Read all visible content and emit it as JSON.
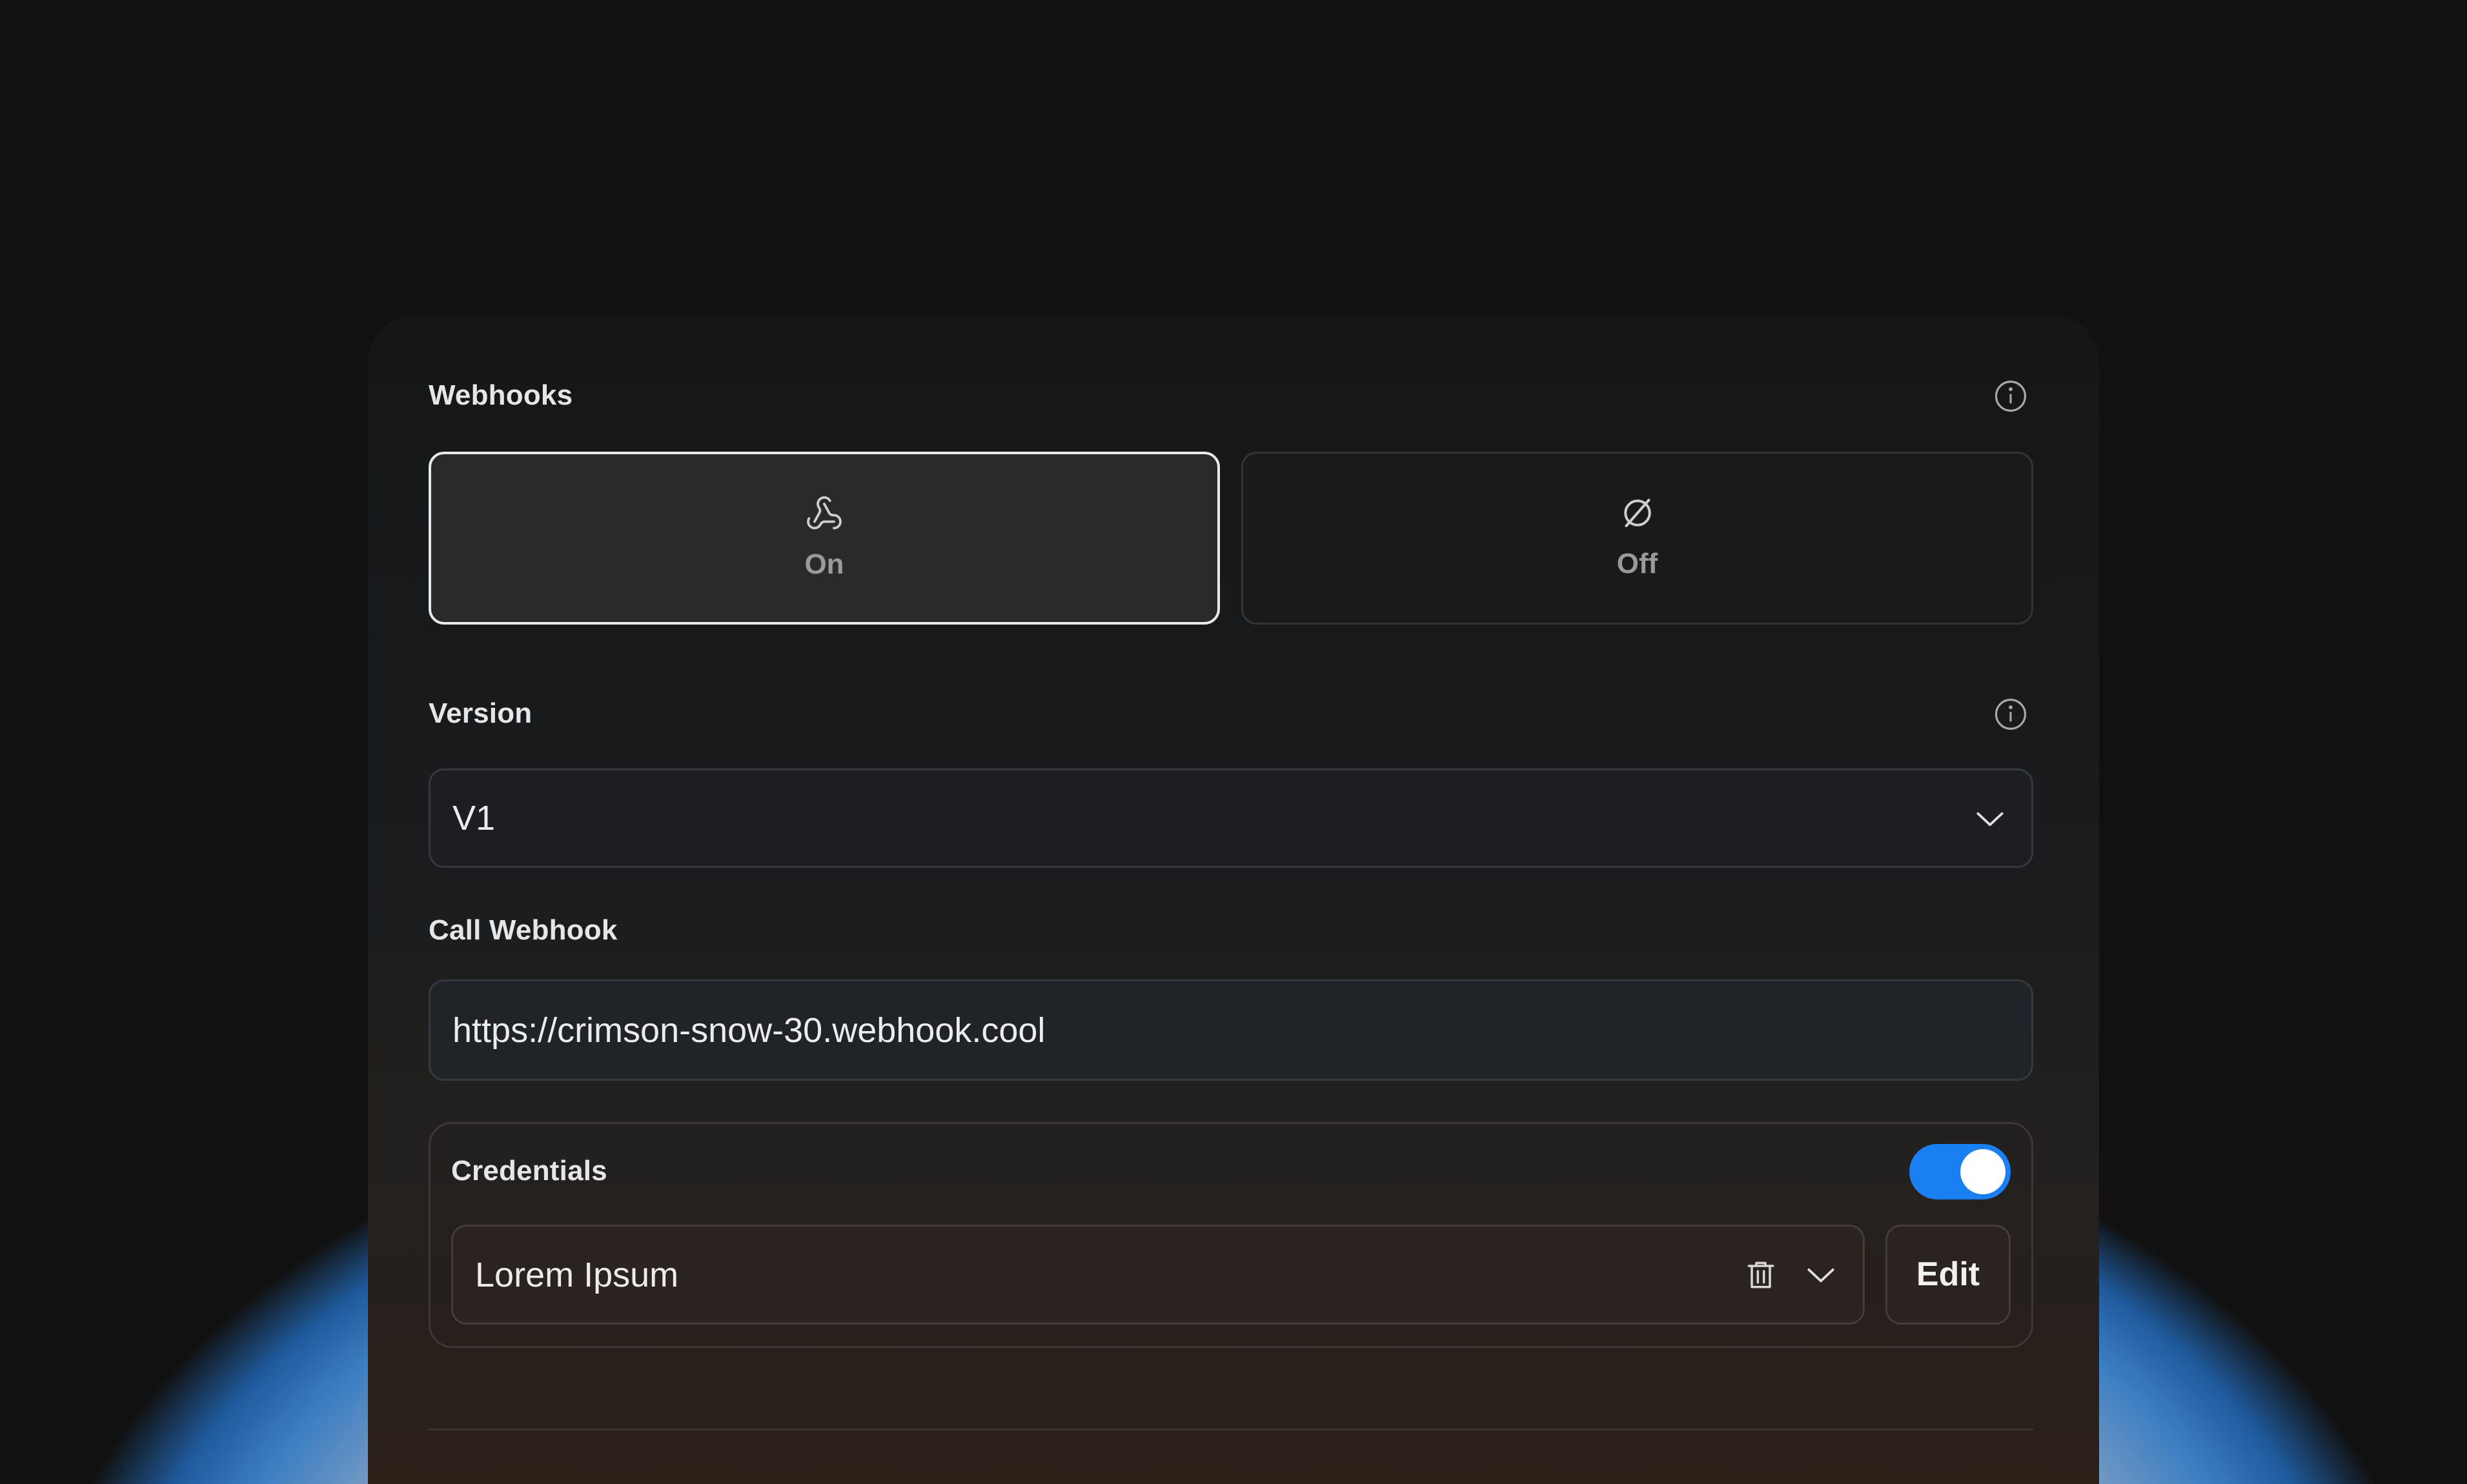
{
  "colors": {
    "accent": "#1a7ff2",
    "panel_bg": "#161616",
    "text_primary": "#e6e6e6",
    "text_muted": "#9a9a9a",
    "selected_border": "#e9e9e9"
  },
  "webhooks": {
    "label": "Webhooks",
    "info_icon": "info-icon",
    "options": [
      {
        "label": "On",
        "icon": "webhook-icon",
        "selected": true
      },
      {
        "label": "Off",
        "icon": "empty-set-icon",
        "selected": false
      }
    ]
  },
  "version": {
    "label": "Version",
    "info_icon": "info-icon",
    "selected_value": "V1",
    "dropdown_icon": "chevron-down-icon"
  },
  "call_webhook": {
    "label": "Call Webhook",
    "url_value": "https://crimson-snow-30.webhook.cool"
  },
  "credentials": {
    "label": "Credentials",
    "toggle_on": true,
    "selected_value": "Lorem Ipsum",
    "delete_icon": "trash-icon",
    "dropdown_icon": "chevron-down-icon",
    "edit_label": "Edit"
  }
}
